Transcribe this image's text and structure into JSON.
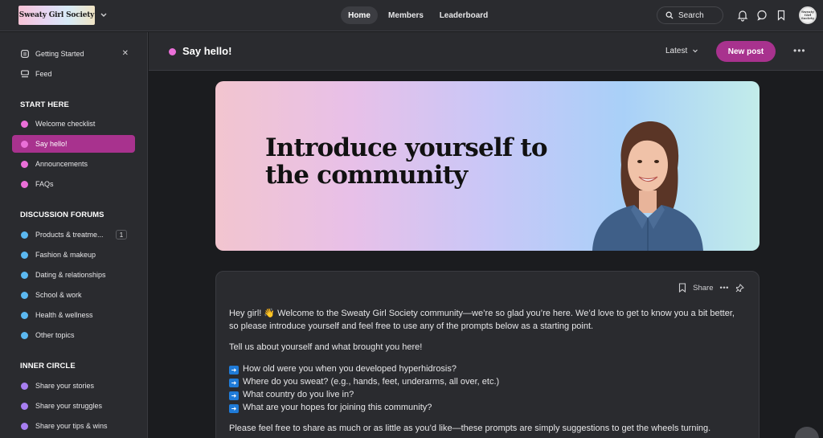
{
  "header": {
    "logo_text": "Sweaty Girl Society",
    "nav": [
      {
        "label": "Home",
        "active": true
      },
      {
        "label": "Members",
        "active": false
      },
      {
        "label": "Leaderboard",
        "active": false
      }
    ],
    "search_label": "Search",
    "icons": [
      "bell-icon",
      "chat-icon",
      "bookmark-icon"
    ],
    "avatar_text": "Sweaty Girl Society"
  },
  "sidebar": {
    "top_items": [
      {
        "label": "Getting Started",
        "icon": "checklist-icon"
      },
      {
        "label": "Feed",
        "icon": "feed-icon"
      }
    ],
    "sections": [
      {
        "heading": "START HERE",
        "items": [
          {
            "label": "Welcome checklist",
            "color": "#ea6fd8"
          },
          {
            "label": "Say hello!",
            "color": "#ea6fd8",
            "active": true
          },
          {
            "label": "Announcements",
            "color": "#ea6fd8"
          },
          {
            "label": "FAQs",
            "color": "#ea6fd8"
          }
        ]
      },
      {
        "heading": "DISCUSSION FORUMS",
        "items": [
          {
            "label": "Products & treatme...",
            "color": "#5bb8f0",
            "badge": "1"
          },
          {
            "label": "Fashion & makeup",
            "color": "#5bb8f0"
          },
          {
            "label": "Dating & relationships",
            "color": "#5bb8f0"
          },
          {
            "label": "School & work",
            "color": "#5bb8f0"
          },
          {
            "label": "Health & wellness",
            "color": "#5bb8f0"
          },
          {
            "label": "Other topics",
            "color": "#5bb8f0"
          }
        ]
      },
      {
        "heading": "INNER CIRCLE",
        "items": [
          {
            "label": "Share your stories",
            "color": "#a77ef0"
          },
          {
            "label": "Share your struggles",
            "color": "#a77ef0"
          },
          {
            "label": "Share your tips & wins",
            "color": "#a77ef0"
          }
        ]
      }
    ]
  },
  "content": {
    "title": "Say hello!",
    "sort_label": "Latest",
    "new_post_label": "New post",
    "banner_title": "Introduce yourself to the community",
    "post": {
      "share_label": "Share",
      "intro": "Hey girl! 👋 Welcome to the Sweaty Girl Society community—we’re so glad you’re here. We’d love to get to know you a bit better, so please introduce yourself and feel free to use any of the prompts below as a starting point.",
      "prompt_line": "Tell us about yourself and what brought you here!",
      "questions": [
        "How old were you when you developed hyperhidrosis?",
        "Where do you sweat? (e.g., hands, feet, underarms, all over, etc.)",
        "What country do you live in?",
        "What are your hopes for joining this community?"
      ],
      "closing": "Please feel free to share as much or as little as you’d like—these prompts are simply suggestions to get the wheels turning."
    }
  },
  "colors": {
    "accent": "#a8328e",
    "start_here_dot": "#ea6fd8",
    "forums_dot": "#5bb8f0",
    "inner_circle_dot": "#a77ef0"
  }
}
